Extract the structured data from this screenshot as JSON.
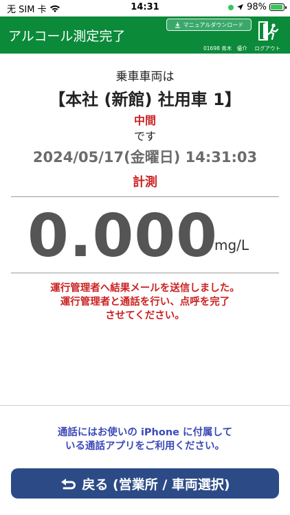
{
  "status_bar": {
    "carrier": "无 SIM 卡",
    "wifi_icon": "wifi-icon",
    "time": "14:31",
    "location_icon": "location-arrow-icon",
    "battery": "98%",
    "battery_level": 0.98
  },
  "header": {
    "title": "アルコール測定完了",
    "manual_button": "マニュアルダウンロード",
    "user": "01698 青木　優介",
    "logout": "ログアウト",
    "color": "#0b8a3a"
  },
  "result": {
    "label": "乗車車両は",
    "vehicle": "【本社 (新館) 社用車 1】",
    "status": "中間",
    "desu": "です",
    "datetime": "2024/05/17(金曜日) 14:31:03",
    "measure_label": "計測",
    "reading": "0.000",
    "unit": "mg/L"
  },
  "notice": {
    "line1": "運行管理者へ結果メールを送信しました。",
    "line2": "運行管理者と通話を行い、点呼を完了",
    "line3": "させてください。"
  },
  "phone_note": {
    "line1": "通話にはお使いの iPhone に付属して",
    "line2": "いる通話アプリをご利用ください。"
  },
  "back_button": {
    "label": "戻る (営業所 / 車両選択)",
    "color": "#2c4a86"
  }
}
